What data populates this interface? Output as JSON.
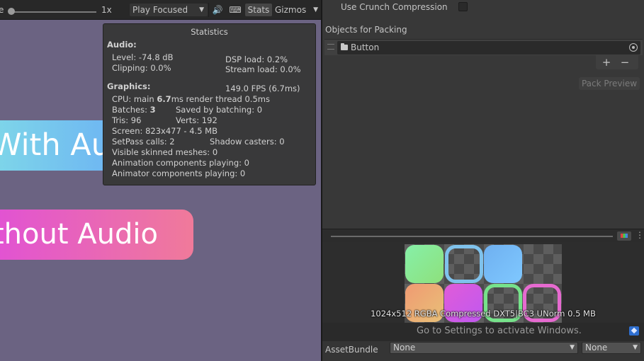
{
  "game_toolbar": {
    "scale_label": "e",
    "scale_value": "1x",
    "play_mode": "Play Focused",
    "mute_icon": "speaker-icon",
    "keyboard_icon": "keyboard-icon",
    "stats_label": "Stats",
    "gizmos_label": "Gizmos"
  },
  "game_view": {
    "button_audio_text": "With Au",
    "button_noaudio_text": "thout Audio"
  },
  "statistics": {
    "title": "Statistics",
    "audio_head": "Audio:",
    "level": "Level: -74.8 dB",
    "dsp_load": "DSP load: 0.2%",
    "clipping": "Clipping: 0.0%",
    "stream_load": "Stream load: 0.0%",
    "graphics_head": "Graphics:",
    "fps": "149.0 FPS (6.7ms)",
    "cpu_prefix": "CPU: main ",
    "cpu_main": "6.7",
    "cpu_suffix": "ms  render thread 0.5ms",
    "batches_prefix": "Batches: ",
    "batches": "3",
    "saved_by_batching": "Saved by batching: 0",
    "tris": "Tris: 96",
    "verts": "Verts: 192",
    "screen": "Screen: 823x477 - 4.5 MB",
    "setpass": "SetPass calls: 2",
    "shadow_casters": "Shadow casters: 0",
    "skinned_meshes": "Visible skinned meshes: 0",
    "animation_components": "Animation components playing: 0",
    "animator_components": "Animator components playing: 0"
  },
  "inspector": {
    "crunch_label": "Use Crunch Compression",
    "crunch_checked": false,
    "objects_label": "Objects for Packing",
    "object_item": "Button",
    "add_label": "+",
    "remove_label": "−",
    "pack_preview_label": "Pack Preview",
    "atlas_info": "1024x512 RGBA Compressed DXT5|BC3 UNorm   0.5 MB",
    "more_label": "⋮",
    "activate_text": "Go to Settings to activate Windows.",
    "bundle_label": "AssetBundle",
    "bundle_value": "None",
    "variant_value": "None"
  }
}
